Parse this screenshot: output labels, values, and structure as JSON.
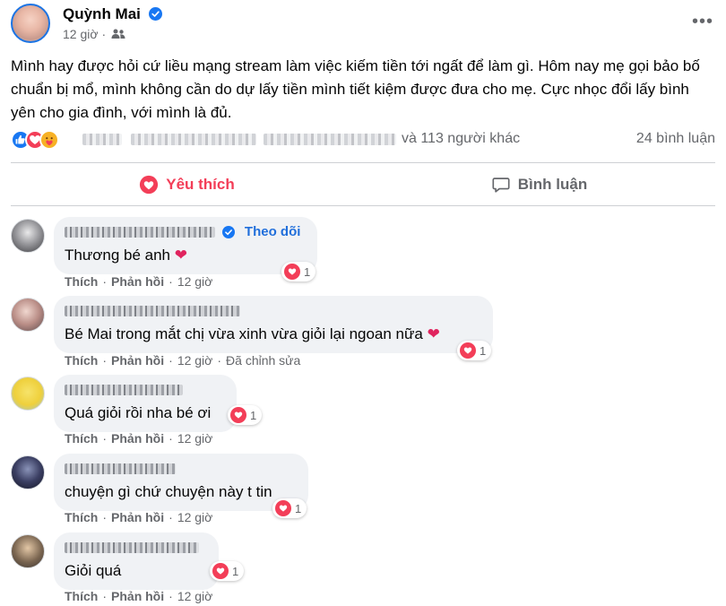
{
  "post": {
    "author": "Quỳnh Mai",
    "time": "12 giờ",
    "more_label": "•••",
    "text": "Mình hay được hỏi cứ liều mạng stream làm việc kiếm tiền tới ngất để làm gì. Hôm nay mẹ gọi bảo bố chuẩn bị mổ, mình không cần do dự lấy tiền mình tiết kiệm được đưa cho mẹ. Cực nhọc đổi lấy bình yên cho gia đình, với mình là đủ.",
    "reaction_summary": "và 113 người khác",
    "comment_count": "24 bình luận",
    "reaction_icons": [
      "like-icon",
      "love-icon",
      "care-icon"
    ]
  },
  "actions": {
    "like_label": "Yêu thích",
    "comment_label": "Bình luận"
  },
  "comment_actions": {
    "like": "Thích",
    "reply": "Phản hồi",
    "separator": "·"
  },
  "comments": [
    {
      "text": "Thương bé anh",
      "reactions": "1",
      "time": "12 giờ",
      "follow": "Theo dõi",
      "edited": ""
    },
    {
      "text": "Bé Mai trong mắt chị vừa xinh vừa giỏi lại ngoan nữa",
      "reactions": "1",
      "time": "12 giờ",
      "follow": "",
      "edited": "Đã chỉnh sửa"
    },
    {
      "text": "Quá giỏi rồi nha bé ơi",
      "reactions": "1",
      "time": "12 giờ",
      "follow": "",
      "edited": ""
    },
    {
      "text": "chuyện gì chứ chuyện này t tin",
      "reactions": "1",
      "time": "12 giờ",
      "follow": "",
      "edited": ""
    },
    {
      "text": "Giỏi quá",
      "reactions": "1",
      "time": "12 giờ",
      "follow": "",
      "edited": ""
    }
  ],
  "colors": {
    "accent": "#1877f2",
    "love": "#f33e58",
    "secondary_text": "#65676b",
    "bubble": "#f0f2f5"
  }
}
